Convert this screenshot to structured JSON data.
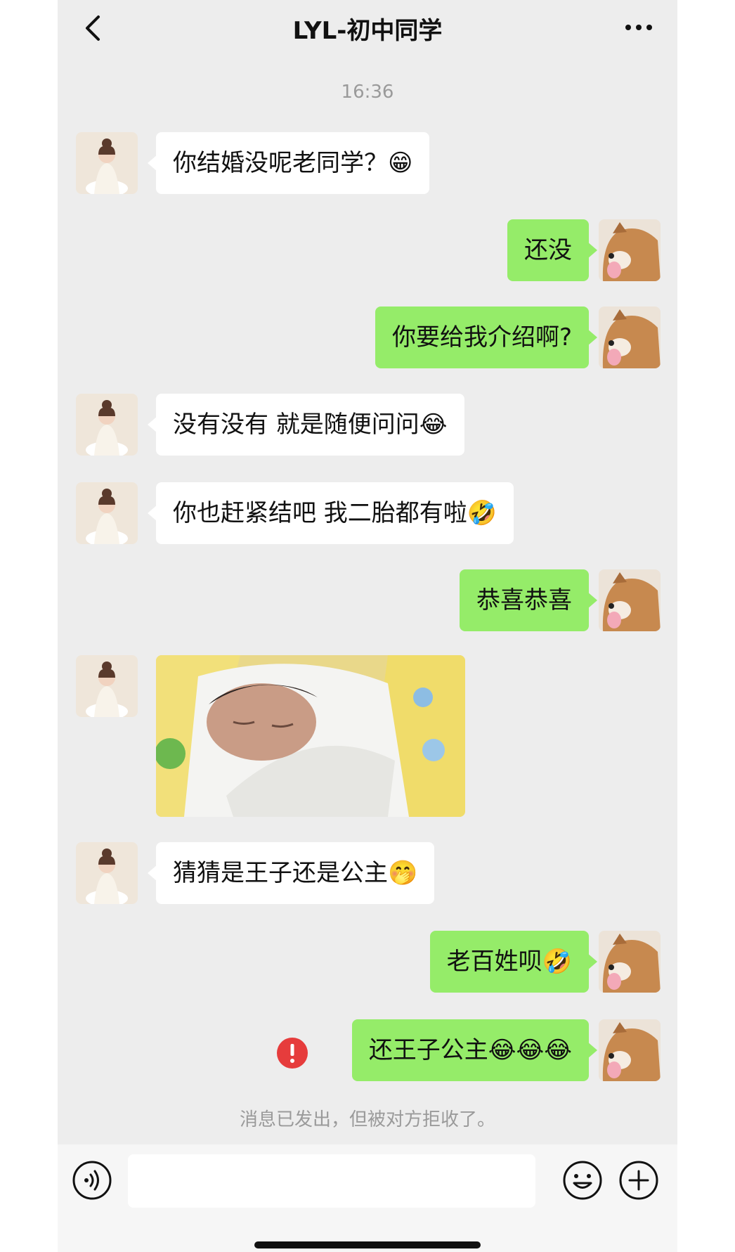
{
  "header": {
    "title": "LYL-初中同学",
    "back_icon": "chevron-left-icon",
    "more_icon": "more-dots-icon"
  },
  "timestamp": "16:36",
  "messages": [
    {
      "side": "left",
      "text": "你结婚没呢老同学？😁"
    },
    {
      "side": "right",
      "text": "还没"
    },
    {
      "side": "right",
      "text": "你要给我介绍啊?"
    },
    {
      "side": "left",
      "text": "没有没有 就是随便问问😂"
    },
    {
      "side": "left",
      "text": "你也赶紧结吧 我二胎都有啦🤣"
    },
    {
      "side": "right",
      "text": "恭喜恭喜"
    },
    {
      "side": "left",
      "image": "newborn-baby-photo"
    },
    {
      "side": "left",
      "text": "猜猜是王子还是公主🤭"
    },
    {
      "side": "right",
      "text": "老百姓呗🤣"
    },
    {
      "side": "right",
      "text": "还王子公主😂😂😂",
      "failed": true
    }
  ],
  "notice": "消息已发出，但被对方拒收了。",
  "input": {
    "voice_icon": "voice-icon",
    "emoji_icon": "emoji-icon",
    "plus_icon": "plus-icon",
    "value": ""
  },
  "colors": {
    "background": "#ededed",
    "sent_bubble": "#95ec69",
    "received_bubble": "#ffffff",
    "error": "#e63c3c"
  }
}
